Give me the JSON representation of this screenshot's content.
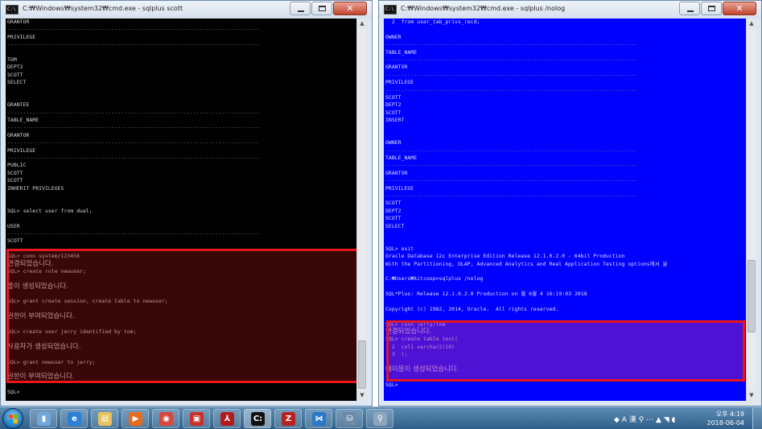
{
  "left_window": {
    "title": "C:₩Windows₩system32₩cmd.exe - sqlplus  scott",
    "lines": [
      {
        "t": "GRANTOR",
        "k": "n"
      },
      {
        "t": "--------------------------------------------------------------------------------",
        "k": "sep"
      },
      {
        "t": "PRIVILEGE",
        "k": "n"
      },
      {
        "t": "--------------------------------------------------------------------------------",
        "k": "sep"
      },
      {
        "t": "",
        "k": "n"
      },
      {
        "t": "TOM",
        "k": "n"
      },
      {
        "t": "DEPT2",
        "k": "n"
      },
      {
        "t": "SCOTT",
        "k": "n"
      },
      {
        "t": "SELECT",
        "k": "n"
      },
      {
        "t": "",
        "k": "n"
      },
      {
        "t": "",
        "k": "n"
      },
      {
        "t": "GRANTEE",
        "k": "n"
      },
      {
        "t": "--------------------------------------------------------------------------------",
        "k": "sep"
      },
      {
        "t": "TABLE_NAME",
        "k": "n"
      },
      {
        "t": "--------------------------------------------------------------------------------",
        "k": "sep"
      },
      {
        "t": "GRANTOR",
        "k": "n"
      },
      {
        "t": "--------------------------------------------------------------------------------",
        "k": "sep"
      },
      {
        "t": "PRIVILEGE",
        "k": "n"
      },
      {
        "t": "--------------------------------------------------------------------------------",
        "k": "sep"
      },
      {
        "t": "PUBLIC",
        "k": "n"
      },
      {
        "t": "SCOTT",
        "k": "n"
      },
      {
        "t": "SCOTT",
        "k": "n"
      },
      {
        "t": "INHERIT PRIVILEGES",
        "k": "n"
      },
      {
        "t": "",
        "k": "n"
      },
      {
        "t": "",
        "k": "n"
      },
      {
        "t": "SQL> select user from dual;",
        "k": "n"
      },
      {
        "t": "",
        "k": "n"
      },
      {
        "t": "USER",
        "k": "n"
      },
      {
        "t": "--------------------------------------------------------------------------------",
        "k": "sep"
      },
      {
        "t": "SCOTT",
        "k": "n"
      },
      {
        "t": "",
        "k": "n"
      },
      {
        "t": "SQL> conn system/123456",
        "k": "n"
      },
      {
        "t": "연결되었습니다.",
        "k": "kr"
      },
      {
        "t": "SQL> create role newuser;",
        "k": "n"
      },
      {
        "t": "",
        "k": "n"
      },
      {
        "t": "롤이 생성되었습니다.",
        "k": "kr"
      },
      {
        "t": "",
        "k": "n"
      },
      {
        "t": "SQL> grant create session, create table to newuser;",
        "k": "n"
      },
      {
        "t": "",
        "k": "n"
      },
      {
        "t": "권한이 부여되었습니다.",
        "k": "kr"
      },
      {
        "t": "",
        "k": "n"
      },
      {
        "t": "SQL> create user jerry identified by tom;",
        "k": "n"
      },
      {
        "t": "",
        "k": "n"
      },
      {
        "t": "사용자가 생성되었습니다.",
        "k": "kr"
      },
      {
        "t": "",
        "k": "n"
      },
      {
        "t": "SQL> grant newuser to jerry;",
        "k": "n"
      },
      {
        "t": "",
        "k": "n"
      },
      {
        "t": "권한이 부여되었습니다.",
        "k": "kr"
      },
      {
        "t": "",
        "k": "n"
      },
      {
        "t": "SQL>",
        "k": "n"
      }
    ]
  },
  "right_window": {
    "title": "C:₩Windows₩system32₩cmd.exe - sqlplus  /nolog",
    "lines": [
      {
        "t": "  2  from user_tab_privs_recd;",
        "k": "n"
      },
      {
        "t": "",
        "k": "n"
      },
      {
        "t": "OWNER",
        "k": "n"
      },
      {
        "t": "--------------------------------------------------------------------------------",
        "k": "sep"
      },
      {
        "t": "TABLE_NAME",
        "k": "n"
      },
      {
        "t": "--------------------------------------------------------------------------------",
        "k": "sep"
      },
      {
        "t": "GRANTOR",
        "k": "n"
      },
      {
        "t": "--------------------------------------------------------------------------------",
        "k": "sep"
      },
      {
        "t": "PRIVILEGE",
        "k": "n"
      },
      {
        "t": "--------------------------------------------------------------------------------",
        "k": "sep"
      },
      {
        "t": "SCOTT",
        "k": "n"
      },
      {
        "t": "DEPT2",
        "k": "n"
      },
      {
        "t": "SCOTT",
        "k": "n"
      },
      {
        "t": "INSERT",
        "k": "n"
      },
      {
        "t": "",
        "k": "n"
      },
      {
        "t": "",
        "k": "n"
      },
      {
        "t": "OWNER",
        "k": "n"
      },
      {
        "t": "--------------------------------------------------------------------------------",
        "k": "sep"
      },
      {
        "t": "TABLE_NAME",
        "k": "n"
      },
      {
        "t": "--------------------------------------------------------------------------------",
        "k": "sep"
      },
      {
        "t": "GRANTOR",
        "k": "n"
      },
      {
        "t": "--------------------------------------------------------------------------------",
        "k": "sep"
      },
      {
        "t": "PRIVILEGE",
        "k": "n"
      },
      {
        "t": "--------------------------------------------------------------------------------",
        "k": "sep"
      },
      {
        "t": "SCOTT",
        "k": "n"
      },
      {
        "t": "DEPT2",
        "k": "n"
      },
      {
        "t": "SCOTT",
        "k": "n"
      },
      {
        "t": "SELECT",
        "k": "n"
      },
      {
        "t": "",
        "k": "n"
      },
      {
        "t": "",
        "k": "n"
      },
      {
        "t": "SQL> exit",
        "k": "n"
      },
      {
        "t": "Oracle Database 12c Enterprise Edition Release 12.1.0.2.0 - 64bit Production",
        "k": "n"
      },
      {
        "t": "With the Partitioning, OLAP, Advanced Analytics and Real Application Testing options에서 분",
        "k": "n"
      },
      {
        "t": "",
        "k": "n"
      },
      {
        "t": "C:₩Users₩kitcoop>sqlplus /nolog",
        "k": "n"
      },
      {
        "t": "",
        "k": "n"
      },
      {
        "t": "SQL*Plus: Release 12.1.0.2.0 Production on 월 6월 4 16:19:03 2018",
        "k": "n"
      },
      {
        "t": "",
        "k": "n"
      },
      {
        "t": "Copyright (c) 1982, 2014, Oracle.  All rights reserved.",
        "k": "n"
      },
      {
        "t": "",
        "k": "n"
      },
      {
        "t": "SQL> conn jerry/tom",
        "k": "n"
      },
      {
        "t": "연결되었습니다.",
        "k": "kr"
      },
      {
        "t": "SQL> create table test(",
        "k": "n"
      },
      {
        "t": "  2  col1 varchar2(10)",
        "k": "n"
      },
      {
        "t": "  3  );",
        "k": "n"
      },
      {
        "t": "",
        "k": "n"
      },
      {
        "t": "테이블이 생성되었습니다.",
        "k": "kr"
      },
      {
        "t": "",
        "k": "n"
      },
      {
        "t": "SQL>",
        "k": "n"
      }
    ]
  },
  "taskbar": {
    "apps": [
      {
        "name": "tb-windows-explorer",
        "glyph": "▮",
        "color": "#6fa8d8"
      },
      {
        "name": "tb-internet-explorer",
        "glyph": "e",
        "color": "#2b7fd6"
      },
      {
        "name": "tb-folder",
        "glyph": "▤",
        "color": "#e8c25a"
      },
      {
        "name": "tb-media-player",
        "glyph": "▶",
        "color": "#e56b1f"
      },
      {
        "name": "tb-chrome",
        "glyph": "◉",
        "color": "#d9473a"
      },
      {
        "name": "tb-app-red",
        "glyph": "▣",
        "color": "#c9302c"
      },
      {
        "name": "tb-acrobat",
        "glyph": "⅄",
        "color": "#b31b1b"
      },
      {
        "name": "tb-cmd",
        "glyph": "C:",
        "color": "#111111"
      },
      {
        "name": "tb-filezilla",
        "glyph": "Z",
        "color": "#b8231f"
      },
      {
        "name": "tb-vscode",
        "glyph": "⋈",
        "color": "#2a78c8"
      },
      {
        "name": "tb-sql-developer",
        "glyph": "⛁",
        "color": "#6b8aa6"
      },
      {
        "name": "tb-search-tool",
        "glyph": "⚲",
        "color": "#8ea6bd"
      }
    ],
    "tray_text": "◆ A 漢 ⚲ ⋯ ▲ ◥ ◖",
    "time": "오후 4:19",
    "date": "2018-06-04"
  }
}
